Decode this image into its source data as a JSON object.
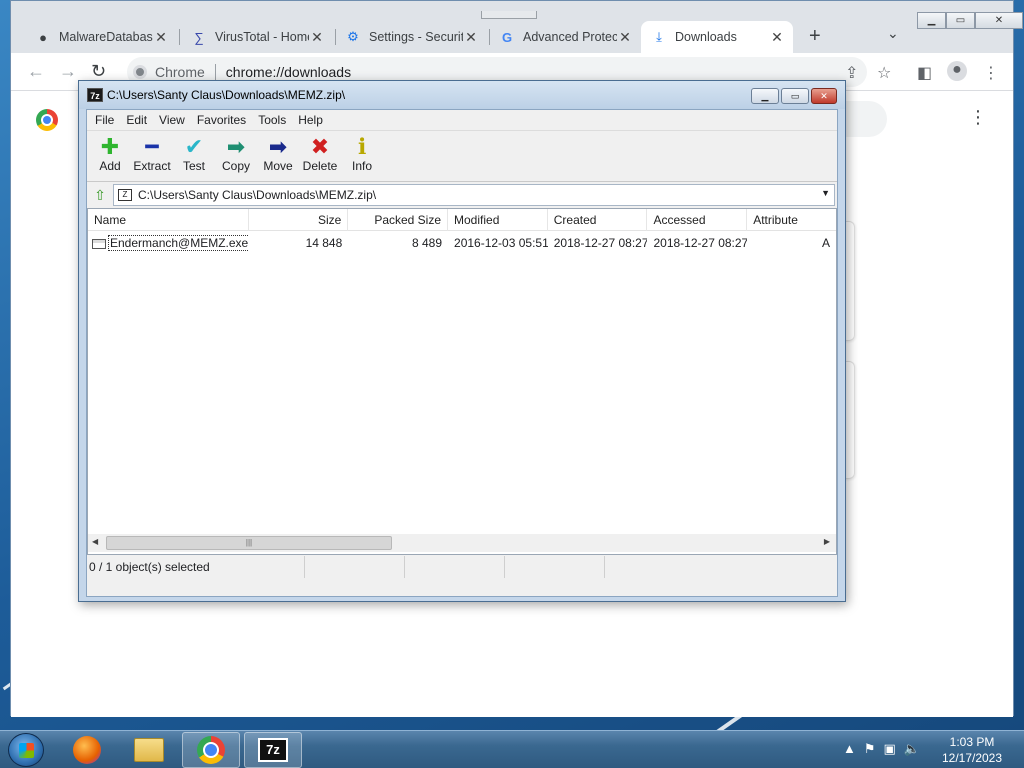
{
  "browser": {
    "tabs": [
      {
        "title": "MalwareDatabase",
        "icon": "github-icon",
        "glyph": "●"
      },
      {
        "title": "VirusTotal - Home",
        "icon": "virustotal-icon",
        "glyph": "∑"
      },
      {
        "title": "Settings - Security",
        "icon": "settings-gear-icon",
        "glyph": "⚙"
      },
      {
        "title": "Advanced Protection",
        "icon": "google-icon",
        "glyph": "G"
      },
      {
        "title": "Downloads",
        "icon": "download-icon",
        "glyph": "⤓"
      }
    ],
    "new_tab": "+",
    "tab_list": "⌄",
    "omnibox": {
      "site_label": "Chrome",
      "url": "chrome://downloads"
    }
  },
  "sevenzip": {
    "title": "C:\\Users\\Santy Claus\\Downloads\\MEMZ.zip\\",
    "menu": [
      "File",
      "Edit",
      "View",
      "Favorites",
      "Tools",
      "Help"
    ],
    "toolbar": [
      {
        "label": "Add",
        "icon": "add-icon",
        "glyph": "✚",
        "color": "#2fb52f"
      },
      {
        "label": "Extract",
        "icon": "extract-icon",
        "glyph": "━",
        "color": "#1a33a8"
      },
      {
        "label": "Test",
        "icon": "test-icon",
        "glyph": "✔",
        "color": "#2ab6c9"
      },
      {
        "label": "Copy",
        "icon": "copy-icon",
        "glyph": "➡",
        "color": "#1f8f72"
      },
      {
        "label": "Move",
        "icon": "move-icon",
        "glyph": "➡",
        "color": "#1a2a8c"
      },
      {
        "label": "Delete",
        "icon": "delete-icon",
        "glyph": "✖",
        "color": "#d02020"
      },
      {
        "label": "Info",
        "icon": "info-icon",
        "glyph": "ℹ",
        "color": "#b8a800"
      }
    ],
    "path": "C:\\Users\\Santy Claus\\Downloads\\MEMZ.zip\\",
    "columns": [
      "Name",
      "Size",
      "Packed Size",
      "Modified",
      "Created",
      "Accessed",
      "Attribute"
    ],
    "rows": [
      {
        "name": "Endermanch@MEMZ.exe",
        "size": "14 848",
        "packed": "8 489",
        "modified": "2016-12-03 05:51",
        "created": "2018-12-27 08:27",
        "accessed": "2018-12-27 08:27",
        "attributes": "A"
      }
    ],
    "status": "0 / 1 object(s) selected"
  },
  "taskbar": {
    "items": [
      "firefox-icon",
      "file-explorer-icon",
      "chrome-icon",
      "7zip-icon"
    ],
    "seven_zip_label": "7z",
    "time": "1:03 PM",
    "date": "12/17/2023"
  }
}
